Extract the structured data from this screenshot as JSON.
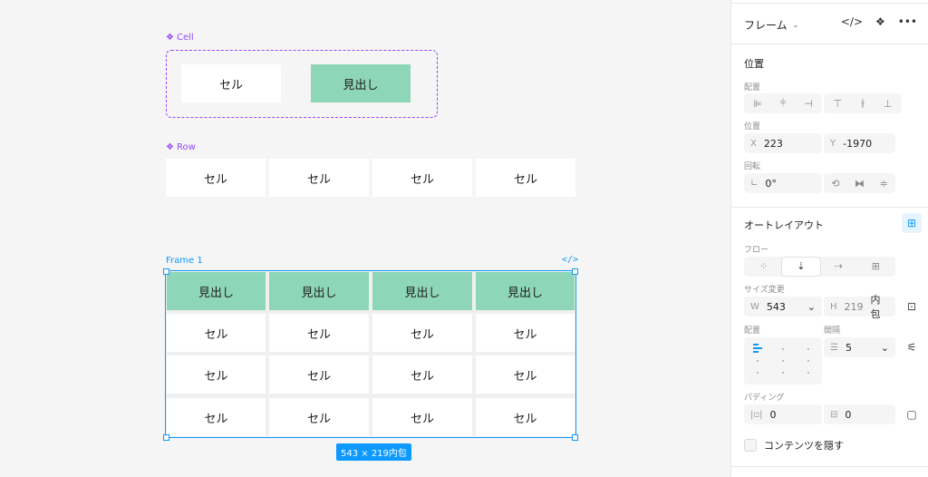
{
  "canvas": {
    "cell_component": {
      "label": "Cell",
      "cells": [
        {
          "text": "セル",
          "type": "body"
        },
        {
          "text": "見出し",
          "type": "head"
        }
      ]
    },
    "row_component": {
      "label": "Row",
      "cells": [
        "セル",
        "セル",
        "セル",
        "セル"
      ]
    },
    "frame": {
      "label": "Frame 1",
      "code_icon": "</>",
      "headers": [
        "見出し",
        "見出し",
        "見出し",
        "見出し"
      ],
      "rows": [
        [
          "セル",
          "セル",
          "セル",
          "セル"
        ],
        [
          "セル",
          "セル",
          "セル",
          "セル"
        ],
        [
          "セル",
          "セル",
          "セル",
          "セル"
        ]
      ],
      "size_badge": "543 × 219内包"
    },
    "colors": {
      "component": "#9747ff",
      "selection": "#0d99ff",
      "header_fill": "#8ed6b8"
    }
  },
  "panel": {
    "title": "フレーム",
    "position": {
      "section": "位置",
      "align_label": "配置",
      "pos_label": "位置",
      "x_prefix": "X",
      "x_value": "223",
      "y_prefix": "Y",
      "y_value": "-1970",
      "rotation_label": "回転",
      "rotation_value": "0°"
    },
    "autolayout": {
      "section": "オートレイアウト",
      "flow_label": "フロー",
      "resize_label": "サイズ変更",
      "w_prefix": "W",
      "w_value": "543",
      "h_prefix": "H",
      "h_value": "219",
      "h_suffix": "内包",
      "align_label": "配置",
      "gap_label": "間隔",
      "gap_value": "5",
      "padding_label": "パディング",
      "padding_h": "0",
      "padding_v": "0",
      "clip_label": "コンテンツを隠す"
    }
  }
}
